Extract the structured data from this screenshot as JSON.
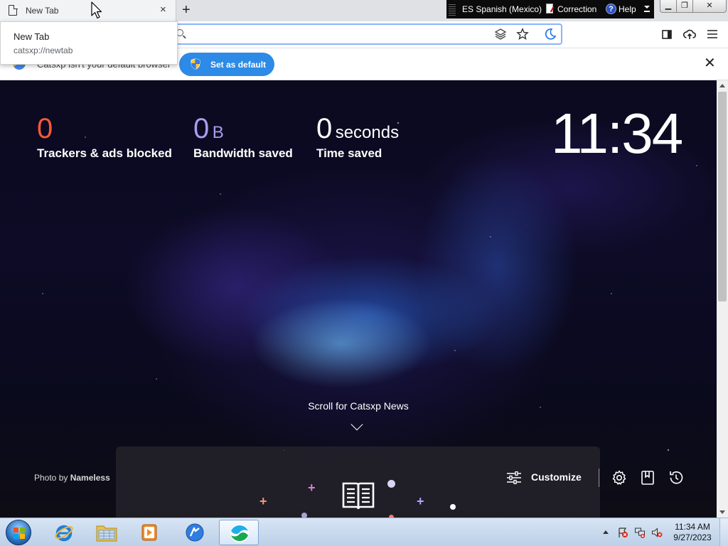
{
  "tab": {
    "title": "New Tab",
    "close_glyph": "×",
    "new_tab_glyph": "+"
  },
  "hover_card": {
    "title": "New Tab",
    "url": "catsxp://newtab"
  },
  "language_bar": {
    "language": "ES Spanish (Mexico)",
    "correction": "Correction",
    "help": "Help",
    "help_glyph": "?"
  },
  "window_controls": {
    "minimize": "▁",
    "restore": "❐",
    "close": "✕"
  },
  "toolbar": {
    "icons": [
      "leo-icon",
      "bookmark-star-icon",
      "night-mode-icon",
      "sidebar-icon",
      "upload-cloud-icon",
      "menu-icon"
    ]
  },
  "infobar": {
    "message": "Catsxp isn't your default browser",
    "button_label": "Set as default",
    "close_glyph": "✕"
  },
  "stats": {
    "trackers": {
      "value": "0",
      "caption": "Trackers & ads blocked"
    },
    "bandwidth": {
      "value": "0",
      "unit": "B",
      "caption": "Bandwidth saved"
    },
    "time": {
      "value": "0",
      "unit": "seconds",
      "caption": "Time saved"
    }
  },
  "clock": "11:34",
  "scroll_hint": "Scroll for Catsxp News",
  "photo_credit": {
    "prefix": "Photo by ",
    "author": "Nameless"
  },
  "customize_label": "Customize",
  "taskbar": {
    "time": "11:34 AM",
    "date": "9/27/2023",
    "pinned": [
      "start-button",
      "internet-explorer-icon",
      "file-explorer-icon",
      "media-player-icon",
      "catsxp-taskbar-icon",
      "browser-taskbar-icon"
    ]
  },
  "colors": {
    "trackers": "#f45a3a",
    "bandwidth": "#a79df0",
    "button_blue": "#2d8ae6",
    "omnibox_focus": "#8ab4f8"
  }
}
